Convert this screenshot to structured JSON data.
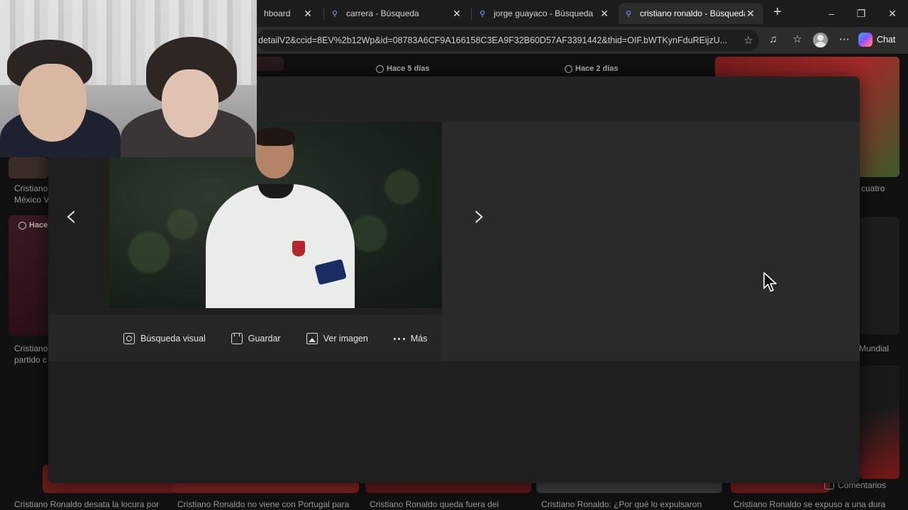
{
  "browser": {
    "tabs": [
      {
        "title": "hboard",
        "active": false
      },
      {
        "title": "carrera - Búsqueda",
        "active": false
      },
      {
        "title": "jorge guayaco - Búsqueda",
        "active": false
      },
      {
        "title": "cristiano ronaldo - Búsqueda d",
        "active": true
      }
    ],
    "new_tab_glyph": "+",
    "url": "detailV2&ccid=8EV%2b12Wp&id=08783A6CF9A166158C3EA9F32B60D57AF3391442&thid=OIF.bWTKynFduREijzU...",
    "chat_label": "Chat"
  },
  "background": {
    "badges": [
      "Hace 5 días",
      "Hace 2 días",
      "Hace"
    ],
    "captions_left": [
      "Cristiano",
      "México V",
      "Cristiano",
      "partido c"
    ],
    "captions_right": [
      "cuatro",
      "Mundial"
    ],
    "bottom_captions": [
      "Cristiano Ronaldo desata la locura por",
      "Cristiano Ronaldo no viene con Portugal para",
      "Cristiano Ronaldo queda fuera del",
      "Cristiano Ronaldo: ¿Por qué lo expulsaron",
      "Cristiano Ronaldo se expuso a una dura"
    ],
    "comments_label": "Comentarios"
  },
  "viewer": {
    "prev_glyph": "‹",
    "next_glyph": "›",
    "actions": [
      {
        "label": "Búsqueda visual",
        "icon": "visual-search-icon"
      },
      {
        "label": "Guardar",
        "icon": "save-icon"
      },
      {
        "label": "Ver imagen",
        "icon": "image-icon"
      },
      {
        "label": "Más",
        "icon": "more-icon"
      }
    ]
  }
}
